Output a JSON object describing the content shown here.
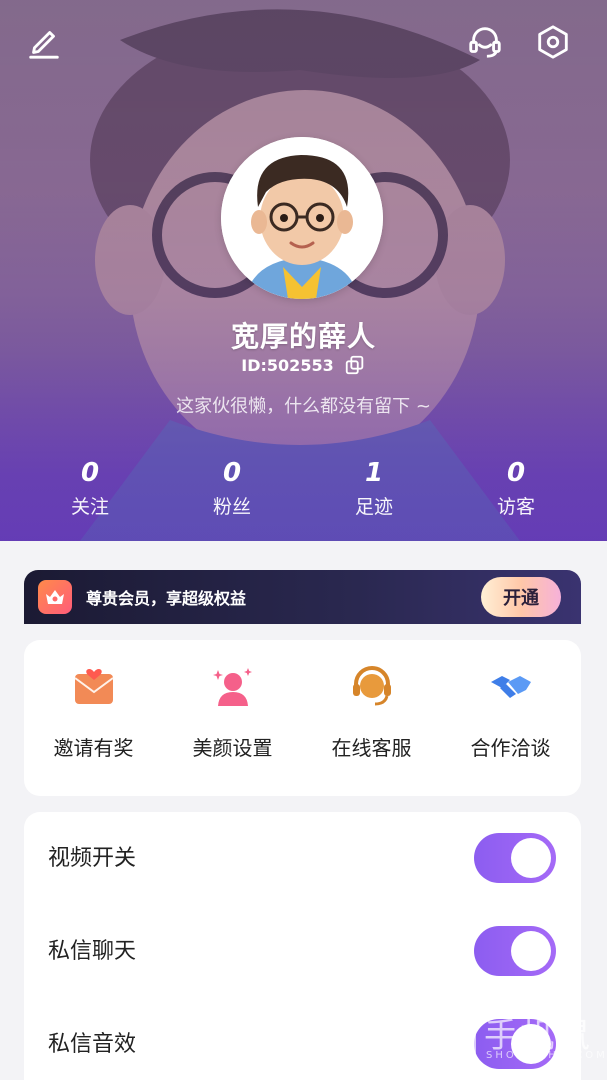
{
  "profile": {
    "username": "宽厚的薛人",
    "id_text": "ID:502553",
    "bio": "这家伙很懒，什么都没有留下 ~"
  },
  "stats": [
    {
      "value": "0",
      "label": "关注"
    },
    {
      "value": "0",
      "label": "粉丝"
    },
    {
      "value": "1",
      "label": "足迹"
    },
    {
      "value": "0",
      "label": "访客"
    }
  ],
  "vip": {
    "text": "尊贵会员，享超级权益",
    "button": "开通"
  },
  "actions": [
    {
      "label": "邀请有奖",
      "icon": "gift-envelope-icon"
    },
    {
      "label": "美颜设置",
      "icon": "beauty-avatar-icon"
    },
    {
      "label": "在线客服",
      "icon": "headset-agent-icon"
    },
    {
      "label": "合作洽谈",
      "icon": "handshake-icon"
    }
  ],
  "toggles": [
    {
      "label": "视频开关",
      "on": true
    },
    {
      "label": "私信聊天",
      "on": true
    },
    {
      "label": "私信音效",
      "on": true
    }
  ],
  "watermark": {
    "text": "手机鼠",
    "sub": "SHOUJISHU.COM"
  },
  "colors": {
    "accent": "#9a63f5",
    "header_bottom": "#6a42b6",
    "vip_bg": "#1b1a33",
    "page_bg": "#f3f3f6"
  }
}
